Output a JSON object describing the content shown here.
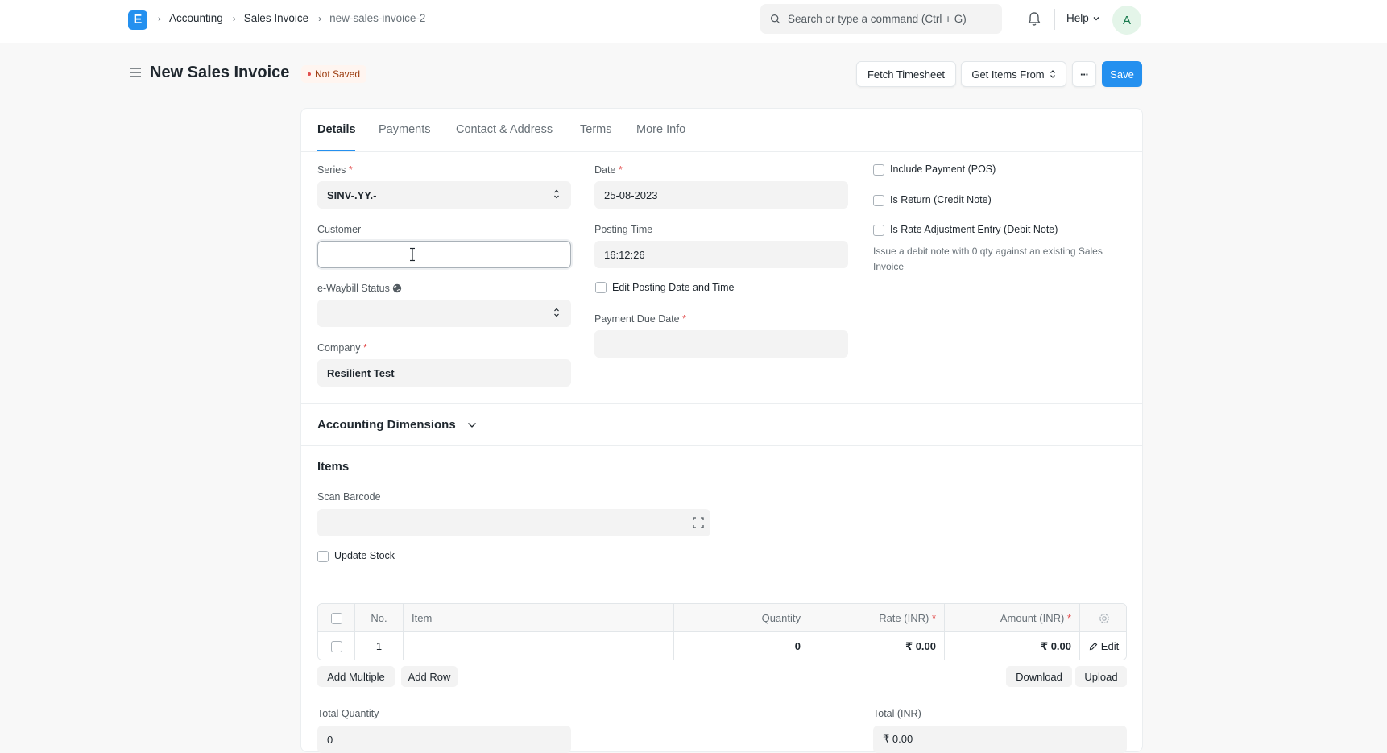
{
  "navbar": {
    "logo_letter": "E",
    "breadcrumbs": [
      "Accounting",
      "Sales Invoice",
      "new-sales-invoice-2"
    ],
    "search_placeholder": "Search or type a command (Ctrl + G)",
    "help_label": "Help",
    "avatar_initial": "A"
  },
  "page": {
    "title": "New Sales Invoice",
    "status": "Not Saved",
    "buttons": {
      "fetch_timesheet": "Fetch Timesheet",
      "get_items_from": "Get Items From",
      "more": "···",
      "save": "Save"
    }
  },
  "tabs": [
    "Details",
    "Payments",
    "Contact & Address",
    "Terms",
    "More Info"
  ],
  "details": {
    "series": {
      "label": "Series",
      "value": "SINV-.YY.-"
    },
    "customer": {
      "label": "Customer",
      "value": ""
    },
    "ewaybill": {
      "label": "e-Waybill Status",
      "value": ""
    },
    "company": {
      "label": "Company",
      "value": "Resilient Test"
    },
    "date": {
      "label": "Date",
      "value": "25-08-2023"
    },
    "posting_time": {
      "label": "Posting Time",
      "value": "16:12:26"
    },
    "edit_posting": "Edit Posting Date and Time",
    "payment_due_date": {
      "label": "Payment Due Date",
      "value": ""
    },
    "include_payment": "Include Payment (POS)",
    "is_return": "Is Return (Credit Note)",
    "is_rate_adjustment": "Is Rate Adjustment Entry (Debit Note)",
    "rate_adjustment_help": "Issue a debit note with 0 qty against an existing Sales Invoice"
  },
  "accounting_dimensions": "Accounting Dimensions",
  "items_section": {
    "title": "Items",
    "scan_barcode": "Scan Barcode",
    "update_stock": "Update Stock",
    "columns": [
      "No.",
      "Item",
      "Quantity",
      "Rate (INR)",
      "Amount (INR)"
    ],
    "rows": [
      {
        "no": "1",
        "item": "",
        "quantity": "0",
        "rate": "₹ 0.00",
        "amount": "₹ 0.00",
        "edit": "Edit"
      }
    ],
    "add_multiple": "Add Multiple",
    "add_row": "Add Row",
    "download": "Download",
    "upload": "Upload"
  },
  "totals": {
    "total_quantity": {
      "label": "Total Quantity",
      "value": "0"
    },
    "total_inr": {
      "label": "Total (INR)",
      "value": "₹ 0.00"
    }
  },
  "colors": {
    "primary": "#2490ef",
    "danger": "#e24c4c"
  }
}
